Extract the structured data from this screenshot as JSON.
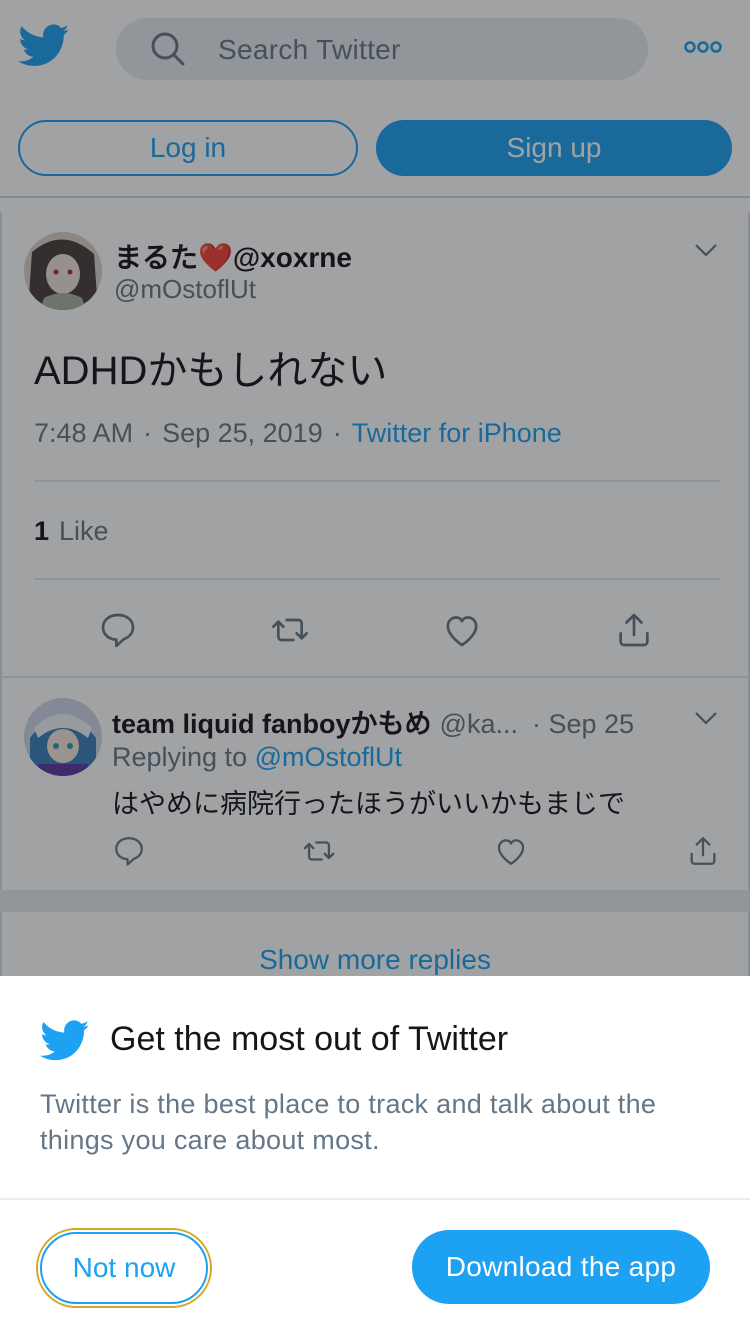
{
  "header": {
    "search_placeholder": "Search Twitter",
    "login_label": "Log in",
    "signup_label": "Sign up"
  },
  "tweet": {
    "display_name": "まるた❤️@xoxrne",
    "handle": "@mOstoflUt",
    "text": "ADHDかもしれない",
    "time": "7:48 AM",
    "date": "Sep 25, 2019",
    "source": "Twitter for iPhone",
    "like_count": "1",
    "like_label": "Like"
  },
  "reply": {
    "display_name": "team liquid fanboyかもめ",
    "handle": "@ka...",
    "date": "Sep 25",
    "replying_prefix": "Replying to",
    "replying_to": "@mOstoflUt",
    "text": "はやめに病院行ったほうがいいかもまじで"
  },
  "show_more": "Show more replies",
  "sheet": {
    "title": "Get the most out of Twitter",
    "description": "Twitter is the best place to track and talk about the things you care about most.",
    "not_now_label": "Not now",
    "download_label": "Download the app"
  },
  "colors": {
    "brand": "#1da1f2",
    "text": "#14171a",
    "secondary": "#657786"
  }
}
